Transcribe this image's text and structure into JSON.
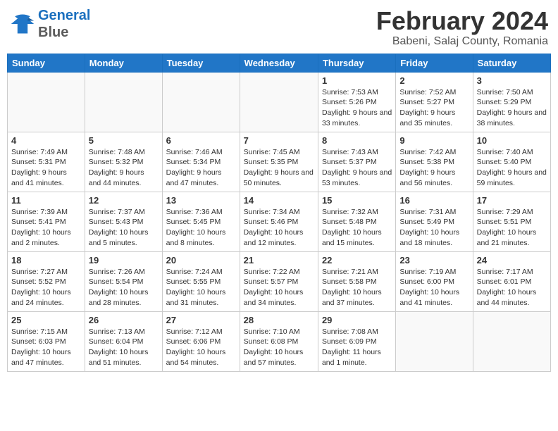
{
  "logo": {
    "line1": "General",
    "line2": "Blue"
  },
  "title": "February 2024",
  "subtitle": "Babeni, Salaj County, Romania",
  "days_of_week": [
    "Sunday",
    "Monday",
    "Tuesday",
    "Wednesday",
    "Thursday",
    "Friday",
    "Saturday"
  ],
  "weeks": [
    [
      {
        "day": "",
        "info": ""
      },
      {
        "day": "",
        "info": ""
      },
      {
        "day": "",
        "info": ""
      },
      {
        "day": "",
        "info": ""
      },
      {
        "day": "1",
        "info": "Sunrise: 7:53 AM\nSunset: 5:26 PM\nDaylight: 9 hours and 33 minutes."
      },
      {
        "day": "2",
        "info": "Sunrise: 7:52 AM\nSunset: 5:27 PM\nDaylight: 9 hours and 35 minutes."
      },
      {
        "day": "3",
        "info": "Sunrise: 7:50 AM\nSunset: 5:29 PM\nDaylight: 9 hours and 38 minutes."
      }
    ],
    [
      {
        "day": "4",
        "info": "Sunrise: 7:49 AM\nSunset: 5:31 PM\nDaylight: 9 hours and 41 minutes."
      },
      {
        "day": "5",
        "info": "Sunrise: 7:48 AM\nSunset: 5:32 PM\nDaylight: 9 hours and 44 minutes."
      },
      {
        "day": "6",
        "info": "Sunrise: 7:46 AM\nSunset: 5:34 PM\nDaylight: 9 hours and 47 minutes."
      },
      {
        "day": "7",
        "info": "Sunrise: 7:45 AM\nSunset: 5:35 PM\nDaylight: 9 hours and 50 minutes."
      },
      {
        "day": "8",
        "info": "Sunrise: 7:43 AM\nSunset: 5:37 PM\nDaylight: 9 hours and 53 minutes."
      },
      {
        "day": "9",
        "info": "Sunrise: 7:42 AM\nSunset: 5:38 PM\nDaylight: 9 hours and 56 minutes."
      },
      {
        "day": "10",
        "info": "Sunrise: 7:40 AM\nSunset: 5:40 PM\nDaylight: 9 hours and 59 minutes."
      }
    ],
    [
      {
        "day": "11",
        "info": "Sunrise: 7:39 AM\nSunset: 5:41 PM\nDaylight: 10 hours and 2 minutes."
      },
      {
        "day": "12",
        "info": "Sunrise: 7:37 AM\nSunset: 5:43 PM\nDaylight: 10 hours and 5 minutes."
      },
      {
        "day": "13",
        "info": "Sunrise: 7:36 AM\nSunset: 5:45 PM\nDaylight: 10 hours and 8 minutes."
      },
      {
        "day": "14",
        "info": "Sunrise: 7:34 AM\nSunset: 5:46 PM\nDaylight: 10 hours and 12 minutes."
      },
      {
        "day": "15",
        "info": "Sunrise: 7:32 AM\nSunset: 5:48 PM\nDaylight: 10 hours and 15 minutes."
      },
      {
        "day": "16",
        "info": "Sunrise: 7:31 AM\nSunset: 5:49 PM\nDaylight: 10 hours and 18 minutes."
      },
      {
        "day": "17",
        "info": "Sunrise: 7:29 AM\nSunset: 5:51 PM\nDaylight: 10 hours and 21 minutes."
      }
    ],
    [
      {
        "day": "18",
        "info": "Sunrise: 7:27 AM\nSunset: 5:52 PM\nDaylight: 10 hours and 24 minutes."
      },
      {
        "day": "19",
        "info": "Sunrise: 7:26 AM\nSunset: 5:54 PM\nDaylight: 10 hours and 28 minutes."
      },
      {
        "day": "20",
        "info": "Sunrise: 7:24 AM\nSunset: 5:55 PM\nDaylight: 10 hours and 31 minutes."
      },
      {
        "day": "21",
        "info": "Sunrise: 7:22 AM\nSunset: 5:57 PM\nDaylight: 10 hours and 34 minutes."
      },
      {
        "day": "22",
        "info": "Sunrise: 7:21 AM\nSunset: 5:58 PM\nDaylight: 10 hours and 37 minutes."
      },
      {
        "day": "23",
        "info": "Sunrise: 7:19 AM\nSunset: 6:00 PM\nDaylight: 10 hours and 41 minutes."
      },
      {
        "day": "24",
        "info": "Sunrise: 7:17 AM\nSunset: 6:01 PM\nDaylight: 10 hours and 44 minutes."
      }
    ],
    [
      {
        "day": "25",
        "info": "Sunrise: 7:15 AM\nSunset: 6:03 PM\nDaylight: 10 hours and 47 minutes."
      },
      {
        "day": "26",
        "info": "Sunrise: 7:13 AM\nSunset: 6:04 PM\nDaylight: 10 hours and 51 minutes."
      },
      {
        "day": "27",
        "info": "Sunrise: 7:12 AM\nSunset: 6:06 PM\nDaylight: 10 hours and 54 minutes."
      },
      {
        "day": "28",
        "info": "Sunrise: 7:10 AM\nSunset: 6:08 PM\nDaylight: 10 hours and 57 minutes."
      },
      {
        "day": "29",
        "info": "Sunrise: 7:08 AM\nSunset: 6:09 PM\nDaylight: 11 hours and 1 minute."
      },
      {
        "day": "",
        "info": ""
      },
      {
        "day": "",
        "info": ""
      }
    ]
  ]
}
